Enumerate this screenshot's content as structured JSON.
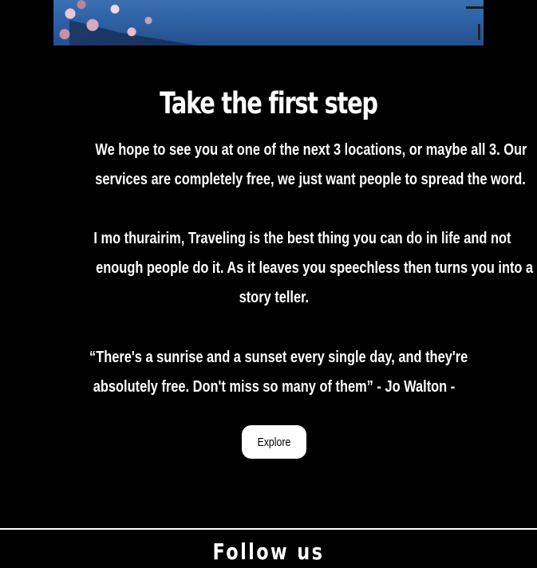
{
  "main": {
    "title": "Take the first step",
    "paragraphs": [
      [
        "We hope to see you at one of the next 3 locations, or maybe all 3. Our",
        "services are completely free, we just want people to spread the word."
      ],
      [
        "I mo thurairim, Traveling is the best thing you can do in life and not",
        "enough people do it. As it leaves you speechless then turns you into a",
        "story teller."
      ],
      [
        "“There's a sunrise and a sunset every single day, and they're",
        "absolutely free. Don't miss so many of them” - Jo Walton -"
      ]
    ],
    "explore_label": "Explore"
  },
  "footer": {
    "title": "Follow us"
  }
}
